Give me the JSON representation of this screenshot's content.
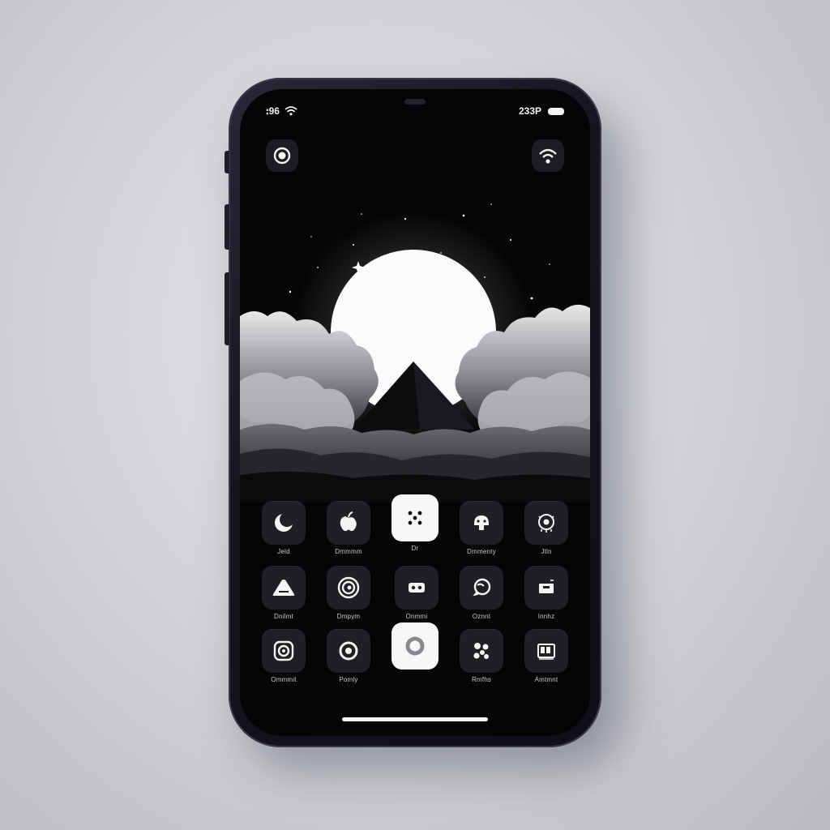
{
  "status_bar": {
    "left_text": "ꓽ96",
    "right_text": "233P"
  },
  "icons": {
    "signal": "signal-icon",
    "wifi": "wifi-icon",
    "battery": "battery-icon",
    "top_left": "camera-ring-icon",
    "top_right": "wifi-broadcast-icon"
  },
  "apps": [
    {
      "label": "Jeld",
      "icon": "moon-icon"
    },
    {
      "label": "Dmmmm",
      "icon": "apple-icon"
    },
    {
      "label": "Dr",
      "icon": "grid-dots-icon"
    },
    {
      "label": "Dmmenty",
      "icon": "ghost-icon"
    },
    {
      "label": "Jtln",
      "icon": "eye-icon"
    },
    {
      "label": "Dnilmt",
      "icon": "triangle-icon"
    },
    {
      "label": "Dmpym",
      "icon": "target-icon"
    },
    {
      "label": "Onmmi",
      "icon": "two-dots-icon"
    },
    {
      "label": "Oznnt",
      "icon": "chat-bubble-icon"
    },
    {
      "label": "Innhz",
      "icon": "card-icon"
    },
    {
      "label": "Ommmit",
      "icon": "spiral-icon"
    },
    {
      "label": "Pomly",
      "icon": "record-icon"
    },
    {
      "label": "",
      "icon": "ring-icon"
    },
    {
      "label": "Rmfhs",
      "icon": "flower-icon"
    },
    {
      "label": "Amtmnt",
      "icon": "calendar-icon"
    }
  ],
  "colors": {
    "screen": "#050507",
    "icon_dark": "#1f1f24",
    "icon_light": "#f7f7f7",
    "text": "#f2f2f2"
  }
}
